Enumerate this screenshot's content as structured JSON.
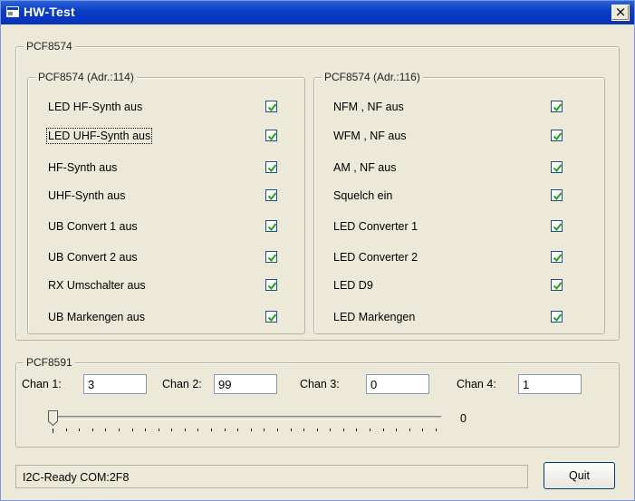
{
  "window": {
    "title": "HW-Test",
    "close_glyph": "×"
  },
  "pcf8574_group": {
    "label": "PCF8574",
    "left_group": {
      "label": "PCF8574 (Adr.:114)",
      "items": [
        {
          "label": "LED HF-Synth aus",
          "checked": true
        },
        {
          "label": "LED UHF-Synth aus",
          "checked": true,
          "focused": true
        },
        {
          "label": "HF-Synth aus",
          "checked": true
        },
        {
          "label": "UHF-Synth aus",
          "checked": true
        },
        {
          "label": "UB Convert 1 aus",
          "checked": true
        },
        {
          "label": "UB Convert 2 aus",
          "checked": true
        },
        {
          "label": "RX Umschalter aus",
          "checked": true
        },
        {
          "label": "UB Markengen aus",
          "checked": true
        }
      ]
    },
    "right_group": {
      "label": "PCF8574 (Adr.:116)",
      "items": [
        {
          "label": "NFM , NF aus",
          "checked": true
        },
        {
          "label": "WFM , NF aus",
          "checked": true
        },
        {
          "label": "AM , NF aus",
          "checked": true
        },
        {
          "label": "Squelch ein",
          "checked": true
        },
        {
          "label": "LED Converter 1",
          "checked": true
        },
        {
          "label": "LED Converter 2",
          "checked": true
        },
        {
          "label": "LED D9",
          "checked": true
        },
        {
          "label": "LED Markengen",
          "checked": true
        }
      ]
    }
  },
  "pcf8591_group": {
    "label": "PCF8591",
    "channels": [
      {
        "label": "Chan 1:",
        "value": "3"
      },
      {
        "label": "Chan 2:",
        "value": "99"
      },
      {
        "label": "Chan 3:",
        "value": "0"
      },
      {
        "label": "Chan 4:",
        "value": "1"
      }
    ],
    "slider": {
      "value": "0",
      "position_fraction": 0
    }
  },
  "status": {
    "text": "I2C-Ready COM:2F8"
  },
  "buttons": {
    "quit": "Quit"
  },
  "colors": {
    "titlebar": "#0a3fc8",
    "face": "#ece9d8",
    "checkmark": "#21a121"
  }
}
